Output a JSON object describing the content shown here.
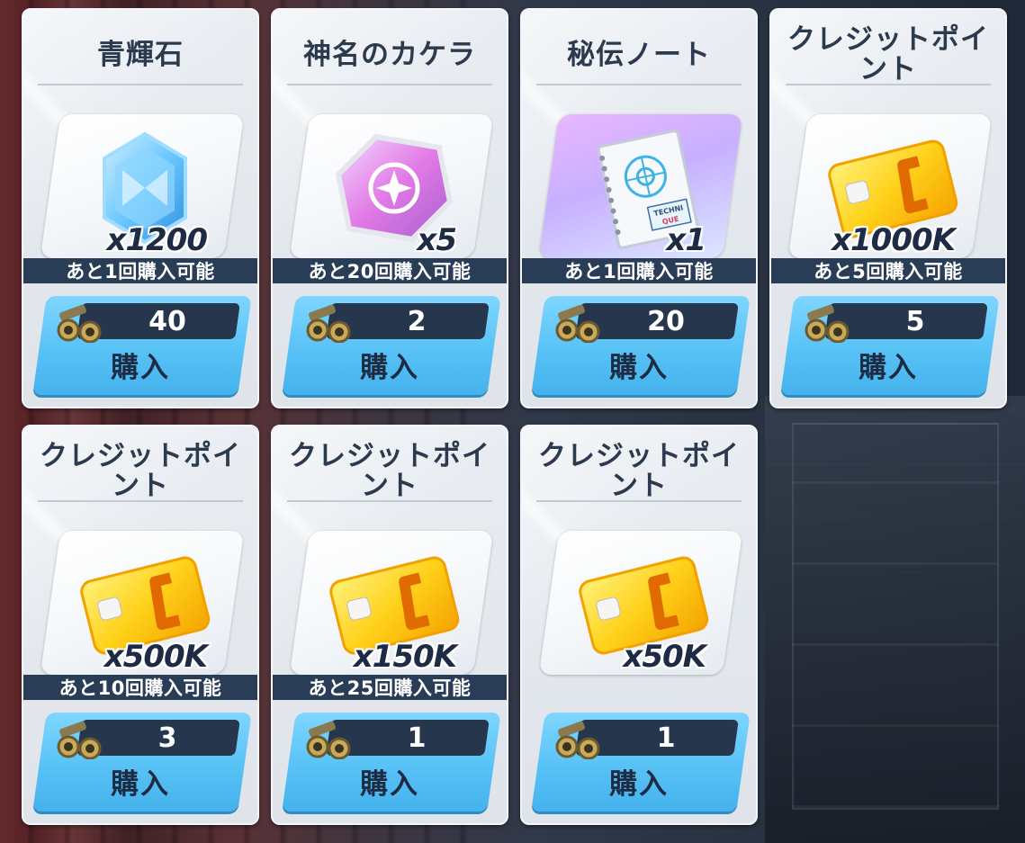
{
  "buy_label": "購入",
  "currency_icon": "binoculars-icon",
  "items": [
    {
      "title": "青輝石",
      "icon": "blue-crystal-icon",
      "quantity": "x1200",
      "limit": "あと1回購入可能",
      "price": "40"
    },
    {
      "title": "神名のカケラ",
      "icon": "pink-fragment-icon",
      "quantity": "x5",
      "limit": "あと20回購入可能",
      "price": "2"
    },
    {
      "title": "秘伝ノート",
      "icon": "technique-notebook-icon",
      "quantity": "x1",
      "limit": "あと1回購入可能",
      "price": "20"
    },
    {
      "title": "クレジットポイント",
      "icon": "credit-card-icon",
      "quantity": "x1000K",
      "limit": "あと5回購入可能",
      "price": "5"
    },
    {
      "title": "クレジットポイント",
      "icon": "credit-card-icon",
      "quantity": "x500K",
      "limit": "あと10回購入可能",
      "price": "3"
    },
    {
      "title": "クレジットポイント",
      "icon": "credit-card-icon",
      "quantity": "x150K",
      "limit": "あと25回購入可能",
      "price": "1"
    },
    {
      "title": "クレジットポイント",
      "icon": "credit-card-icon",
      "quantity": "x50K",
      "limit": "",
      "price": "1"
    }
  ]
}
